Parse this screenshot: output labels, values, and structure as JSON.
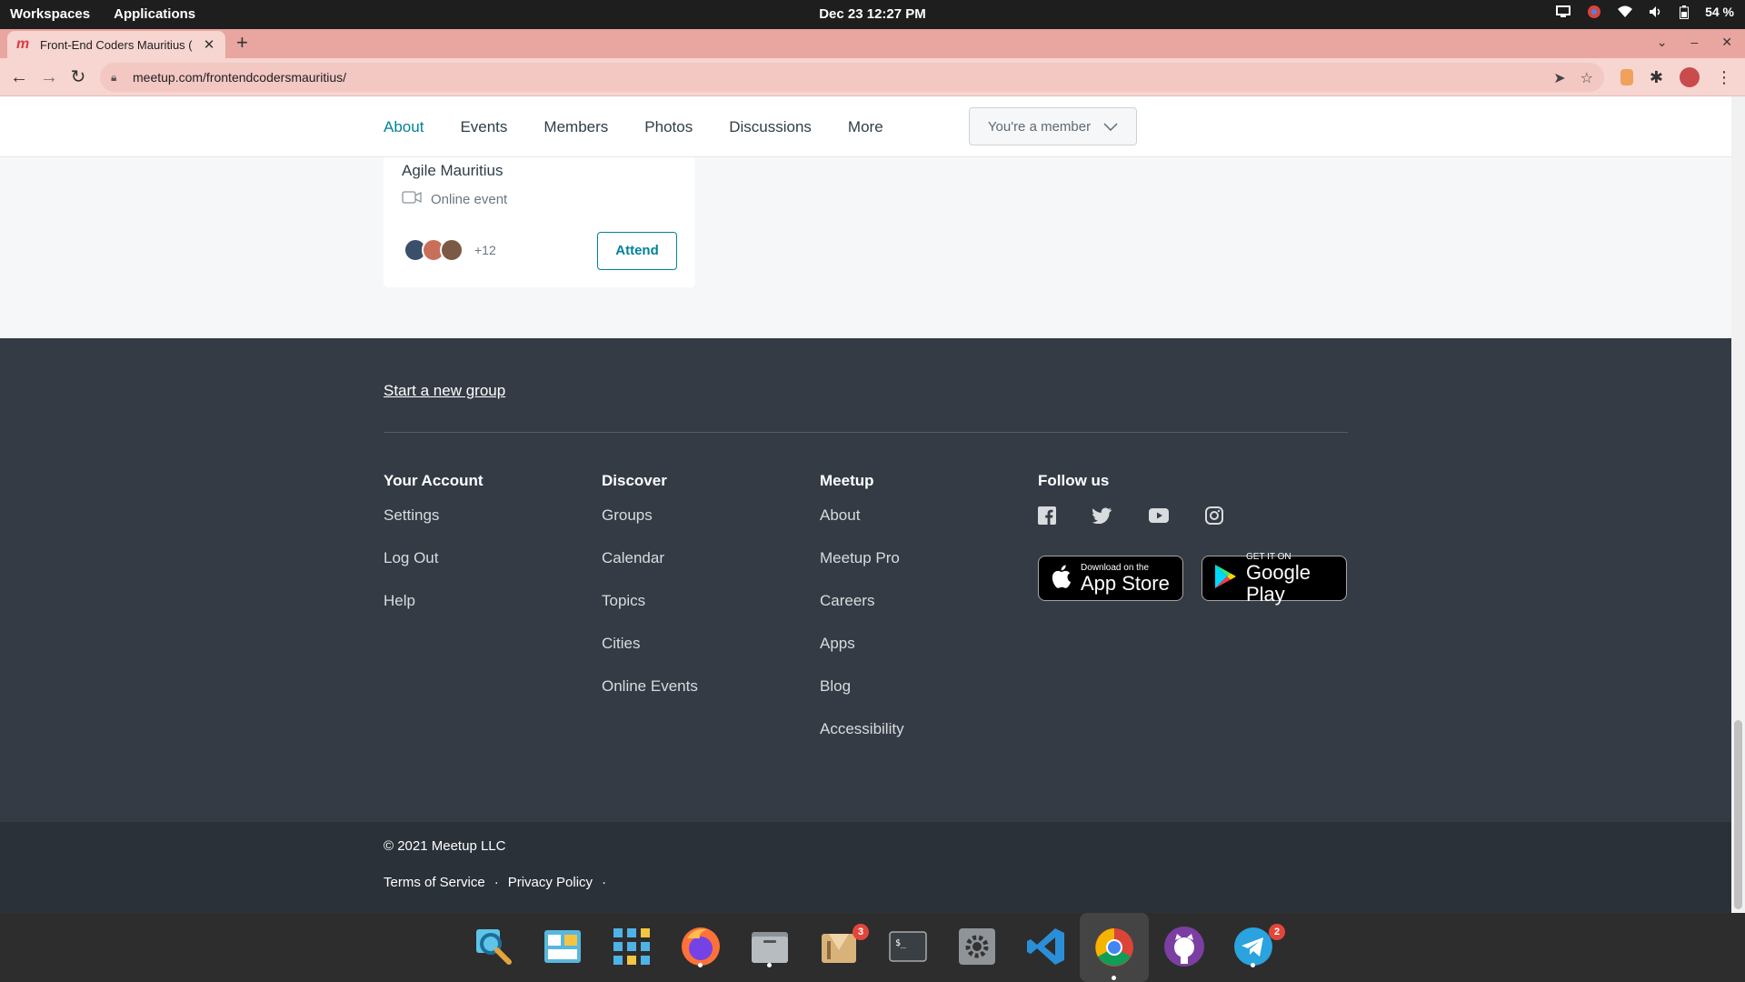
{
  "os_bar": {
    "workspaces": "Workspaces",
    "applications": "Applications",
    "clock": "Dec 23  12:27 PM",
    "battery": "54 %"
  },
  "browser": {
    "tab_title": "Front-End Coders Mauritius (",
    "url": "meetup.com/frontendcodersmauritius/"
  },
  "subnav": {
    "links": [
      "About",
      "Events",
      "Members",
      "Photos",
      "Discussions",
      "More"
    ],
    "active": "About",
    "member_button": "You're a member"
  },
  "event_card": {
    "group_name": "Agile Mauritius",
    "location": "Online event",
    "attendee_extra": "+12",
    "attend_button": "Attend"
  },
  "footer": {
    "start_group": "Start a new group",
    "columns": [
      {
        "heading": "Your Account",
        "items": [
          "Settings",
          "Log Out",
          "Help"
        ]
      },
      {
        "heading": "Discover",
        "items": [
          "Groups",
          "Calendar",
          "Topics",
          "Cities",
          "Online Events"
        ]
      },
      {
        "heading": "Meetup",
        "items": [
          "About",
          "Meetup Pro",
          "Careers",
          "Apps",
          "Blog",
          "Accessibility"
        ]
      }
    ],
    "follow_heading": "Follow us",
    "app_store": {
      "small": "Download on the",
      "big": "App Store"
    },
    "google_play": {
      "small": "GET IT ON",
      "big": "Google Play"
    }
  },
  "subfooter": {
    "copyright": "© 2021 Meetup LLC",
    "terms": "Terms of Service",
    "privacy": "Privacy Policy",
    "separator": "·"
  },
  "dock": {
    "badges": {
      "archive": "3",
      "telegram": "2"
    }
  },
  "colors": {
    "accent": "#00829b",
    "footer_bg": "#343b44",
    "tab_strip": "#e9a59f"
  }
}
